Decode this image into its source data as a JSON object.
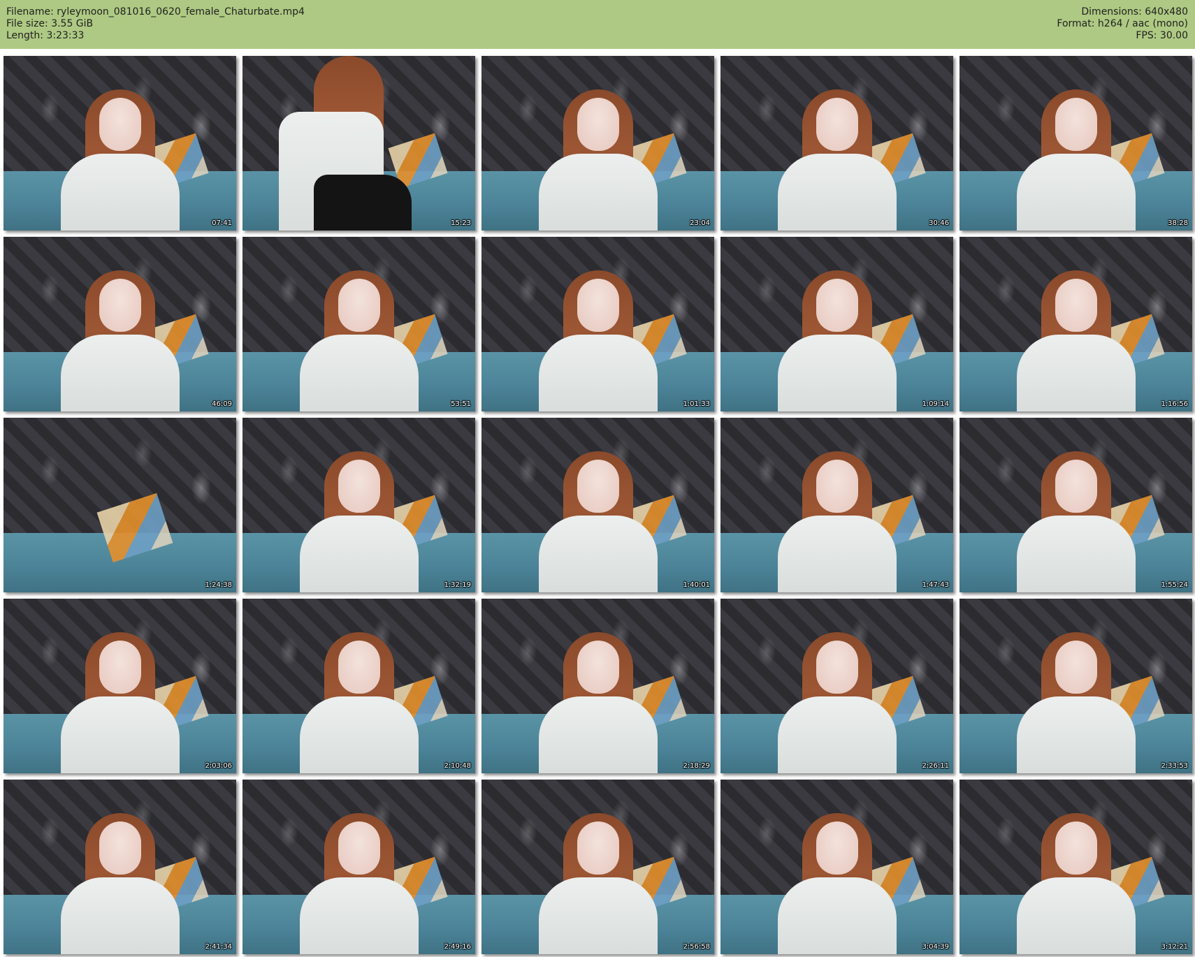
{
  "header": {
    "left": [
      "Filename: ryleymoon_081016_0620_female_Chaturbate.mp4",
      "File size: 3.55 GiB",
      "Length: 3:23:33"
    ],
    "right": [
      "Dimensions: 640x480",
      "Format: h264 / aac (mono)",
      "FPS: 30.00"
    ],
    "background_color": "#aec983"
  },
  "thumbnails": [
    {
      "timestamp": "07:41"
    },
    {
      "timestamp": "15:23"
    },
    {
      "timestamp": "23:04"
    },
    {
      "timestamp": "30:46"
    },
    {
      "timestamp": "38:28"
    },
    {
      "timestamp": "46:09"
    },
    {
      "timestamp": "53:51"
    },
    {
      "timestamp": "1:01:33"
    },
    {
      "timestamp": "1:09:14"
    },
    {
      "timestamp": "1:16:56"
    },
    {
      "timestamp": "1:24:38"
    },
    {
      "timestamp": "1:32:19"
    },
    {
      "timestamp": "1:40:01"
    },
    {
      "timestamp": "1:47:43"
    },
    {
      "timestamp": "1:55:24"
    },
    {
      "timestamp": "2:03:06"
    },
    {
      "timestamp": "2:10:48"
    },
    {
      "timestamp": "2:18:29"
    },
    {
      "timestamp": "2:26:11"
    },
    {
      "timestamp": "2:33:53"
    },
    {
      "timestamp": "2:41:34"
    },
    {
      "timestamp": "2:49:16"
    },
    {
      "timestamp": "2:56:58"
    },
    {
      "timestamp": "3:04:39"
    },
    {
      "timestamp": "3:12:21"
    }
  ]
}
